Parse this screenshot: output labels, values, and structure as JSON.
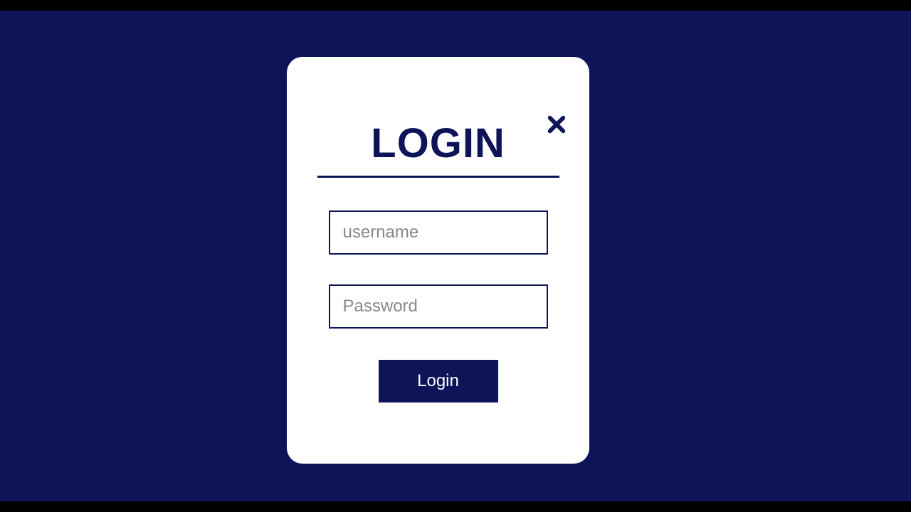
{
  "login": {
    "title": "LOGIN",
    "username_placeholder": "username",
    "password_placeholder": "Password",
    "button_label": "Login"
  }
}
